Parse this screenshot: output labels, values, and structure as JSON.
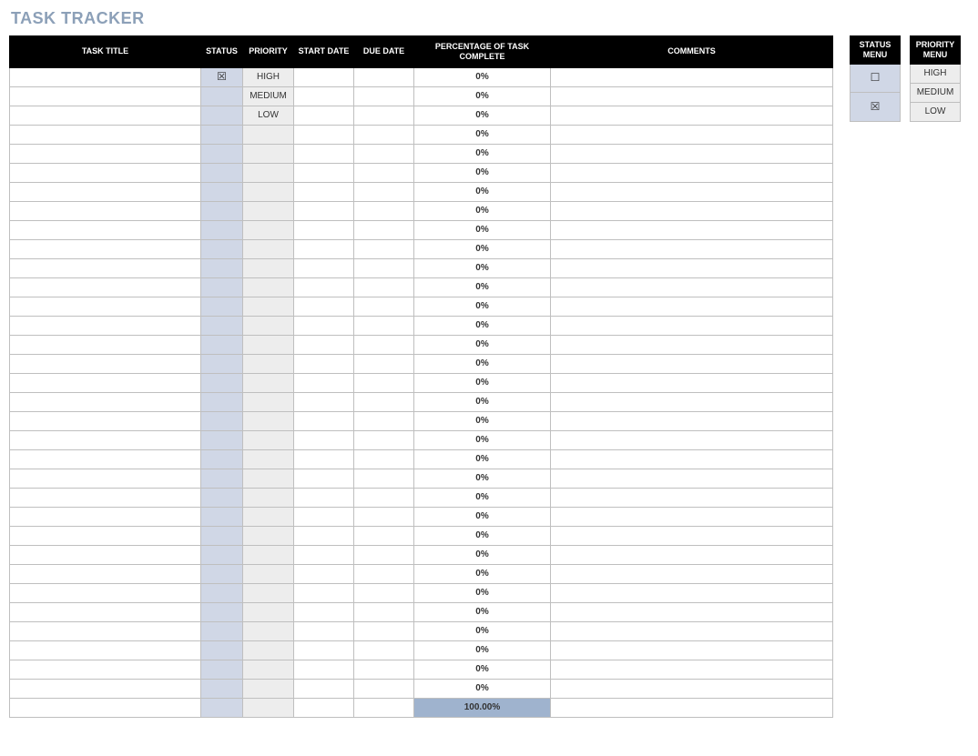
{
  "title": "TASK TRACKER",
  "columns": {
    "task_title": "TASK TITLE",
    "status": "STATUS",
    "priority": "PRIORITY",
    "start_date": "START DATE",
    "due_date": "DUE DATE",
    "pct_complete": "PERCENTAGE OF TASK COMPLETE",
    "comments": "COMMENTS"
  },
  "status_menu": {
    "header": "STATUS MENU",
    "options": [
      "☐",
      "☒"
    ]
  },
  "priority_menu": {
    "header": "PRIORITY MENU",
    "options": [
      "HIGH",
      "MEDIUM",
      "LOW"
    ]
  },
  "rows": [
    {
      "title": "",
      "status": "☒",
      "priority": "HIGH",
      "start": "",
      "due": "",
      "pct": "0%",
      "comments": ""
    },
    {
      "title": "",
      "status": "",
      "priority": "MEDIUM",
      "start": "",
      "due": "",
      "pct": "0%",
      "comments": ""
    },
    {
      "title": "",
      "status": "",
      "priority": "LOW",
      "start": "",
      "due": "",
      "pct": "0%",
      "comments": ""
    },
    {
      "title": "",
      "status": "",
      "priority": "",
      "start": "",
      "due": "",
      "pct": "0%",
      "comments": ""
    },
    {
      "title": "",
      "status": "",
      "priority": "",
      "start": "",
      "due": "",
      "pct": "0%",
      "comments": ""
    },
    {
      "title": "",
      "status": "",
      "priority": "",
      "start": "",
      "due": "",
      "pct": "0%",
      "comments": ""
    },
    {
      "title": "",
      "status": "",
      "priority": "",
      "start": "",
      "due": "",
      "pct": "0%",
      "comments": ""
    },
    {
      "title": "",
      "status": "",
      "priority": "",
      "start": "",
      "due": "",
      "pct": "0%",
      "comments": ""
    },
    {
      "title": "",
      "status": "",
      "priority": "",
      "start": "",
      "due": "",
      "pct": "0%",
      "comments": ""
    },
    {
      "title": "",
      "status": "",
      "priority": "",
      "start": "",
      "due": "",
      "pct": "0%",
      "comments": ""
    },
    {
      "title": "",
      "status": "",
      "priority": "",
      "start": "",
      "due": "",
      "pct": "0%",
      "comments": ""
    },
    {
      "title": "",
      "status": "",
      "priority": "",
      "start": "",
      "due": "",
      "pct": "0%",
      "comments": ""
    },
    {
      "title": "",
      "status": "",
      "priority": "",
      "start": "",
      "due": "",
      "pct": "0%",
      "comments": ""
    },
    {
      "title": "",
      "status": "",
      "priority": "",
      "start": "",
      "due": "",
      "pct": "0%",
      "comments": ""
    },
    {
      "title": "",
      "status": "",
      "priority": "",
      "start": "",
      "due": "",
      "pct": "0%",
      "comments": ""
    },
    {
      "title": "",
      "status": "",
      "priority": "",
      "start": "",
      "due": "",
      "pct": "0%",
      "comments": ""
    },
    {
      "title": "",
      "status": "",
      "priority": "",
      "start": "",
      "due": "",
      "pct": "0%",
      "comments": ""
    },
    {
      "title": "",
      "status": "",
      "priority": "",
      "start": "",
      "due": "",
      "pct": "0%",
      "comments": ""
    },
    {
      "title": "",
      "status": "",
      "priority": "",
      "start": "",
      "due": "",
      "pct": "0%",
      "comments": ""
    },
    {
      "title": "",
      "status": "",
      "priority": "",
      "start": "",
      "due": "",
      "pct": "0%",
      "comments": ""
    },
    {
      "title": "",
      "status": "",
      "priority": "",
      "start": "",
      "due": "",
      "pct": "0%",
      "comments": ""
    },
    {
      "title": "",
      "status": "",
      "priority": "",
      "start": "",
      "due": "",
      "pct": "0%",
      "comments": ""
    },
    {
      "title": "",
      "status": "",
      "priority": "",
      "start": "",
      "due": "",
      "pct": "0%",
      "comments": ""
    },
    {
      "title": "",
      "status": "",
      "priority": "",
      "start": "",
      "due": "",
      "pct": "0%",
      "comments": ""
    },
    {
      "title": "",
      "status": "",
      "priority": "",
      "start": "",
      "due": "",
      "pct": "0%",
      "comments": ""
    },
    {
      "title": "",
      "status": "",
      "priority": "",
      "start": "",
      "due": "",
      "pct": "0%",
      "comments": ""
    },
    {
      "title": "",
      "status": "",
      "priority": "",
      "start": "",
      "due": "",
      "pct": "0%",
      "comments": ""
    },
    {
      "title": "",
      "status": "",
      "priority": "",
      "start": "",
      "due": "",
      "pct": "0%",
      "comments": ""
    },
    {
      "title": "",
      "status": "",
      "priority": "",
      "start": "",
      "due": "",
      "pct": "0%",
      "comments": ""
    },
    {
      "title": "",
      "status": "",
      "priority": "",
      "start": "",
      "due": "",
      "pct": "0%",
      "comments": ""
    },
    {
      "title": "",
      "status": "",
      "priority": "",
      "start": "",
      "due": "",
      "pct": "0%",
      "comments": ""
    },
    {
      "title": "",
      "status": "",
      "priority": "",
      "start": "",
      "due": "",
      "pct": "0%",
      "comments": ""
    },
    {
      "title": "",
      "status": "",
      "priority": "",
      "start": "",
      "due": "",
      "pct": "0%",
      "comments": ""
    }
  ],
  "total_pct": "100.00%"
}
